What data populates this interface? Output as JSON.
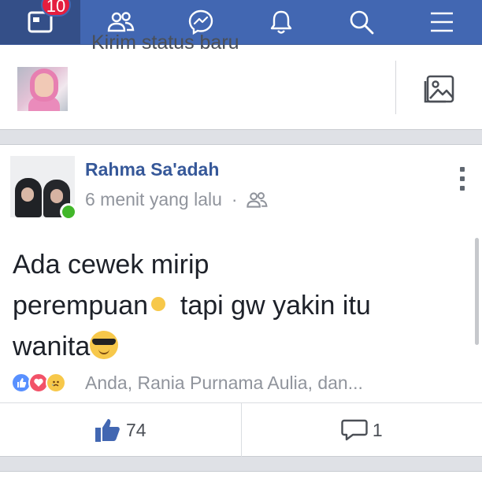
{
  "nav": {
    "notification_count": "10",
    "items": [
      "home-icon",
      "friends-icon",
      "messenger-icon",
      "notifications-icon",
      "search-icon",
      "menu-icon"
    ]
  },
  "composer": {
    "placeholder": "Kirim status baru"
  },
  "post": {
    "author": "Rahma Sa'adah",
    "time": "6 menit yang lalu",
    "separator": "·",
    "privacy": "friends-icon",
    "text_line1": "Ada cewek mirip",
    "text_line2a": "perempuan",
    "text_line2b": "tapi gw yakin itu",
    "text_line3": "wanita",
    "reactions": [
      "like",
      "love",
      "sad"
    ],
    "reactors": "Anda, Rania Purnama Aulia, dan...",
    "like_count": "74",
    "comment_count": "1"
  },
  "colors": {
    "nav": "#4267b2",
    "link": "#365899",
    "online": "#42b72a",
    "badge": "#e41e3f"
  }
}
